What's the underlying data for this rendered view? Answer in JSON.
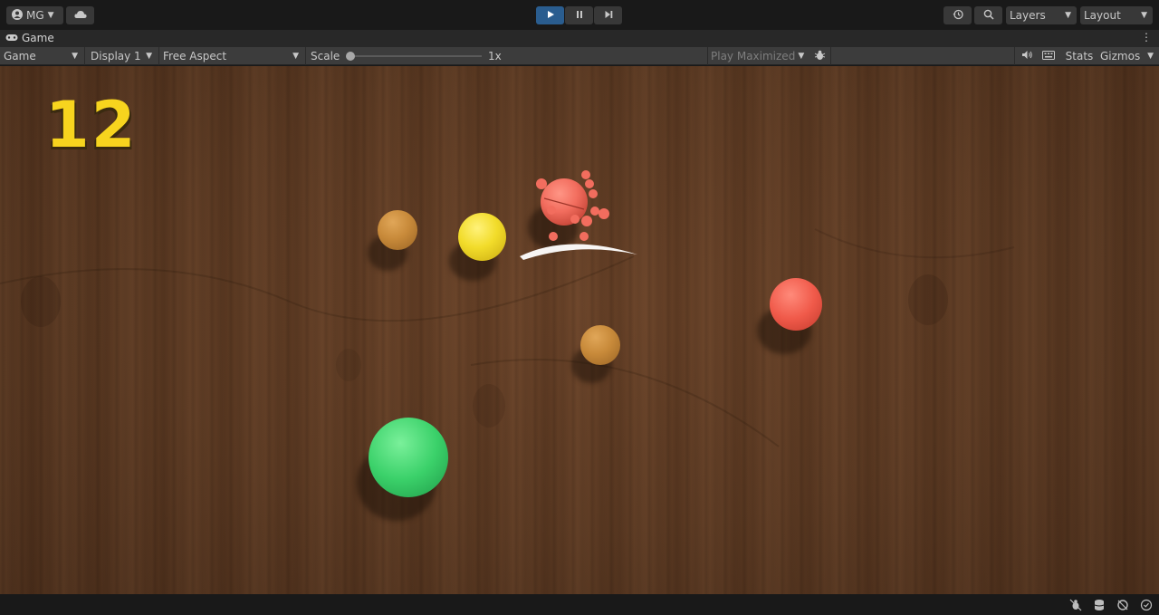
{
  "toolbar": {
    "account_label": "MG",
    "layers_label": "Layers",
    "layout_label": "Layout"
  },
  "tab": {
    "title": "Game"
  },
  "controls": {
    "view_mode": "Game",
    "display": "Display 1",
    "aspect": "Free Aspect",
    "scale_label": "Scale",
    "scale_value": "1x",
    "play_maximized": "Play Maximized",
    "stats_label": "Stats",
    "gizmos_label": "Gizmos"
  },
  "game": {
    "score": "12",
    "balls": [
      {
        "name": "orange-ball",
        "color": "#c88a3a"
      },
      {
        "name": "yellow-ball",
        "color": "#f2dc2a"
      },
      {
        "name": "red-ball",
        "color": "#f05a4a"
      },
      {
        "name": "orange-ball-2",
        "color": "#c88a3a"
      },
      {
        "name": "green-ball",
        "color": "#3bd16a"
      },
      {
        "name": "sliced-red-ball",
        "color": "#f26d5e"
      }
    ]
  },
  "colors": {
    "accent": "#2a5d8f",
    "score": "#f7d41e",
    "wood": "#5d3a22"
  },
  "icons": [
    "account-icon",
    "cloud-icon",
    "play-icon",
    "pause-icon",
    "step-icon",
    "history-icon",
    "search-icon",
    "gamepad-icon",
    "kebab-icon",
    "bug-icon",
    "audio-icon",
    "keyboard-icon"
  ]
}
